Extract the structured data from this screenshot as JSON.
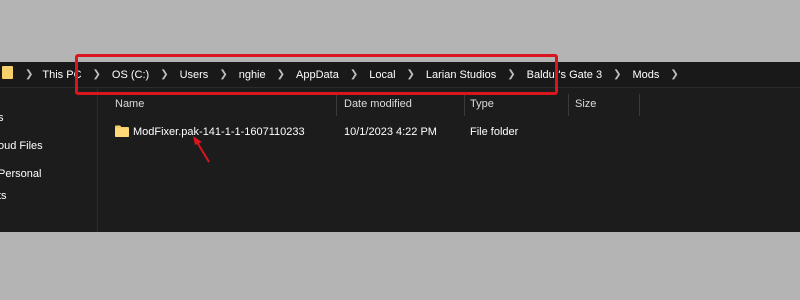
{
  "breadcrumb": {
    "items": [
      "This PC",
      "OS (C:)",
      "Users",
      "nghie",
      "AppData",
      "Local",
      "Larian Studios",
      "Baldur's Gate 3",
      "Mods"
    ]
  },
  "nav": {
    "items": [
      "s",
      "oud Files",
      "Personal",
      "ts"
    ]
  },
  "columns": {
    "name": "Name",
    "date_modified": "Date modified",
    "type": "Type",
    "size": "Size"
  },
  "files": [
    {
      "name": "ModFixer.pak-141-1-1-1607110233",
      "date_modified": "10/1/2023 4:22 PM",
      "type": "File folder",
      "size": ""
    }
  ],
  "colors": {
    "highlight": "#d9151d",
    "folder": "#f4cf6a",
    "background": "#1c1c1c"
  },
  "icons": {
    "folder": "folder-icon",
    "chevron": "chevron-right-icon",
    "annotation": "red-arrow-icon"
  }
}
